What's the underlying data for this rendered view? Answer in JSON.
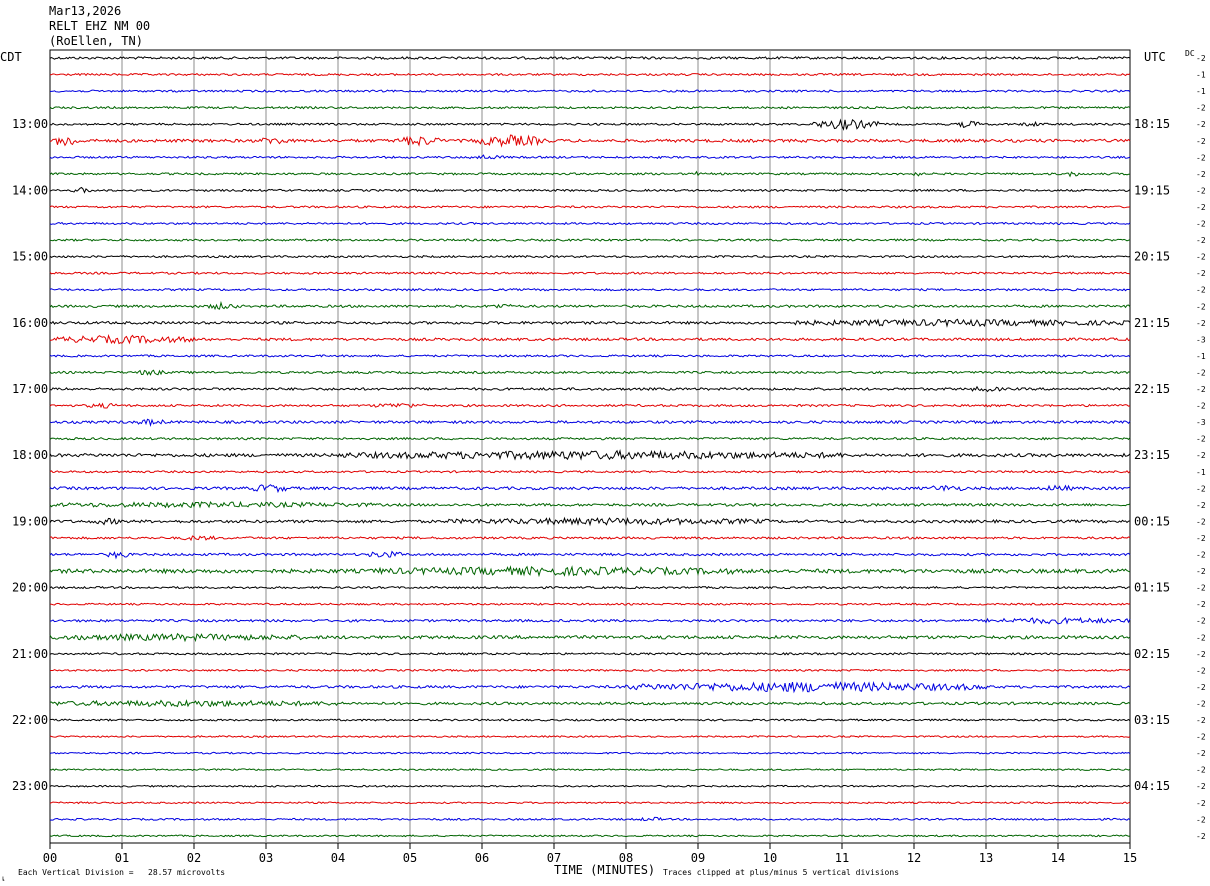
{
  "header": {
    "date": "Mar13,2026",
    "channel": "RELT EHZ NM 00",
    "location": "(RoEllen, TN)"
  },
  "labels": {
    "left_tz": "CDT",
    "right_tz": "UTC",
    "dc": "DC",
    "corner_mark": "เ"
  },
  "footer": {
    "scale_text": "Each Vertical Division =   28.57 microvolts",
    "clip_text": "Traces clipped at plus/minus 5 vertical divisions"
  },
  "colors": {
    "trace_cycle": [
      "#000000",
      "#e00000",
      "#0000e0",
      "#006400"
    ],
    "grid": "#8c8c8c"
  },
  "chart_data": {
    "type": "line",
    "title": "",
    "xlabel": "TIME (MINUTES)",
    "ylabel": "",
    "xlim": [
      0,
      15
    ],
    "x_ticks": [
      "00",
      "01",
      "02",
      "03",
      "04",
      "05",
      "06",
      "07",
      "08",
      "09",
      "10",
      "11",
      "12",
      "13",
      "14",
      "15"
    ],
    "left_hour_labels": [
      "13:00",
      "14:00",
      "15:00",
      "16:00",
      "17:00",
      "18:00",
      "19:00",
      "20:00",
      "21:00",
      "22:00",
      "23:00"
    ],
    "right_hour_labels": [
      "18:15",
      "19:15",
      "20:15",
      "21:15",
      "22:15",
      "23:15",
      "00:15",
      "01:15",
      "02:15",
      "03:15",
      "04:15"
    ],
    "hour_label_start_trace": 4,
    "traces_per_hour": 4,
    "dc_offsets": [
      "-2",
      "-1",
      "-1",
      "-2",
      "-2",
      "-2",
      "-2",
      "-2",
      "-2",
      "-2",
      "-2",
      "-2",
      "-2",
      "-2",
      "-2",
      "-2",
      "-2",
      "-3",
      "-1",
      "-2",
      "-2",
      "-2",
      "-3",
      "-2",
      "-2",
      "-1",
      "-2",
      "-2",
      "-2",
      "-2",
      "-2",
      "-2",
      "-2",
      "-2",
      "-2",
      "-2",
      "-2",
      "-2",
      "-2",
      "-2",
      "-2",
      "-2",
      "-2",
      "-2",
      "-2",
      "-2",
      "-2",
      "-2"
    ],
    "series": [
      {
        "amplitude": 1.2,
        "events": []
      },
      {
        "amplitude": 1.0,
        "events": []
      },
      {
        "amplitude": 1.0,
        "events": []
      },
      {
        "amplitude": 1.0,
        "events": []
      },
      {
        "amplitude": 1.0,
        "events": [
          [
            10.6,
            11.5,
            4.5
          ],
          [
            12.6,
            12.9,
            3
          ],
          [
            13.5,
            13.8,
            1.5
          ]
        ]
      },
      {
        "amplitude": 1.5,
        "events": [
          [
            0.05,
            0.4,
            5
          ],
          [
            2.9,
            3.3,
            2.5
          ],
          [
            4.8,
            5.4,
            4
          ],
          [
            5.9,
            6.9,
            4.5
          ]
        ]
      },
      {
        "amplitude": 1.0,
        "events": [
          [
            5.8,
            6.3,
            1.5
          ]
        ]
      },
      {
        "amplitude": 1.0,
        "events": [
          [
            8.9,
            9.0,
            2.5
          ],
          [
            11.9,
            12.1,
            2
          ],
          [
            14.1,
            14.3,
            2
          ]
        ]
      },
      {
        "amplitude": 1.0,
        "events": [
          [
            0.3,
            0.6,
            2
          ]
        ]
      },
      {
        "amplitude": 1.0,
        "events": []
      },
      {
        "amplitude": 1.0,
        "events": []
      },
      {
        "amplitude": 1.0,
        "events": []
      },
      {
        "amplitude": 1.0,
        "events": []
      },
      {
        "amplitude": 1.0,
        "events": []
      },
      {
        "amplitude": 1.0,
        "events": []
      },
      {
        "amplitude": 1.2,
        "events": [
          [
            2.2,
            2.6,
            2.5
          ],
          [
            6.1,
            6.4,
            1.5
          ]
        ]
      },
      {
        "amplitude": 1.3,
        "events": [
          [
            10.1,
            15.0,
            2.2
          ]
        ]
      },
      {
        "amplitude": 1.3,
        "events": [
          [
            0.05,
            2.0,
            3
          ]
        ]
      },
      {
        "amplitude": 1.0,
        "events": []
      },
      {
        "amplitude": 1.1,
        "events": [
          [
            1.2,
            1.6,
            2
          ]
        ]
      },
      {
        "amplitude": 1.2,
        "events": [
          [
            12.8,
            13.2,
            1.8
          ]
        ]
      },
      {
        "amplitude": 1.1,
        "events": [
          [
            0.5,
            1.0,
            1.5
          ],
          [
            4.5,
            5.2,
            1.5
          ]
        ]
      },
      {
        "amplitude": 1.3,
        "events": [
          [
            1.2,
            1.6,
            2
          ]
        ]
      },
      {
        "amplitude": 1.1,
        "events": []
      },
      {
        "amplitude": 1.6,
        "events": [
          [
            4.0,
            11.0,
            3
          ]
        ]
      },
      {
        "amplitude": 1.0,
        "events": []
      },
      {
        "amplitude": 1.4,
        "events": [
          [
            2.8,
            3.3,
            3
          ],
          [
            12.2,
            12.7,
            2
          ],
          [
            13.8,
            14.2,
            2
          ]
        ]
      },
      {
        "amplitude": 1.3,
        "events": [
          [
            0.0,
            4.5,
            1.6
          ]
        ]
      },
      {
        "amplitude": 1.4,
        "events": [
          [
            0.6,
            1.0,
            2
          ],
          [
            5.5,
            10.0,
            2.2
          ]
        ]
      },
      {
        "amplitude": 1.1,
        "events": [
          [
            1.8,
            2.3,
            1.5
          ]
        ]
      },
      {
        "amplitude": 1.2,
        "events": [
          [
            0.8,
            1.1,
            3
          ],
          [
            4.4,
            4.9,
            2.5
          ]
        ]
      },
      {
        "amplitude": 2.0,
        "events": [
          [
            4.5,
            9.5,
            2.5
          ]
        ]
      },
      {
        "amplitude": 1.0,
        "events": []
      },
      {
        "amplitude": 0.9,
        "events": []
      },
      {
        "amplitude": 1.2,
        "events": [
          [
            13.0,
            15.0,
            2
          ]
        ]
      },
      {
        "amplitude": 1.6,
        "events": [
          [
            0.0,
            3.5,
            2
          ]
        ]
      },
      {
        "amplitude": 1.0,
        "events": []
      },
      {
        "amplitude": 0.9,
        "events": []
      },
      {
        "amplitude": 1.3,
        "events": [
          [
            8.0,
            13.0,
            4
          ]
        ]
      },
      {
        "amplitude": 1.3,
        "events": [
          [
            0.0,
            4.0,
            2
          ]
        ]
      },
      {
        "amplitude": 0.9,
        "events": []
      },
      {
        "amplitude": 0.8,
        "events": []
      },
      {
        "amplitude": 0.8,
        "events": []
      },
      {
        "amplitude": 0.8,
        "events": []
      },
      {
        "amplitude": 0.8,
        "events": []
      },
      {
        "amplitude": 0.8,
        "events": []
      },
      {
        "amplitude": 0.9,
        "events": [
          [
            8.2,
            8.5,
            1.5
          ]
        ]
      },
      {
        "amplitude": 0.8,
        "events": []
      }
    ]
  }
}
